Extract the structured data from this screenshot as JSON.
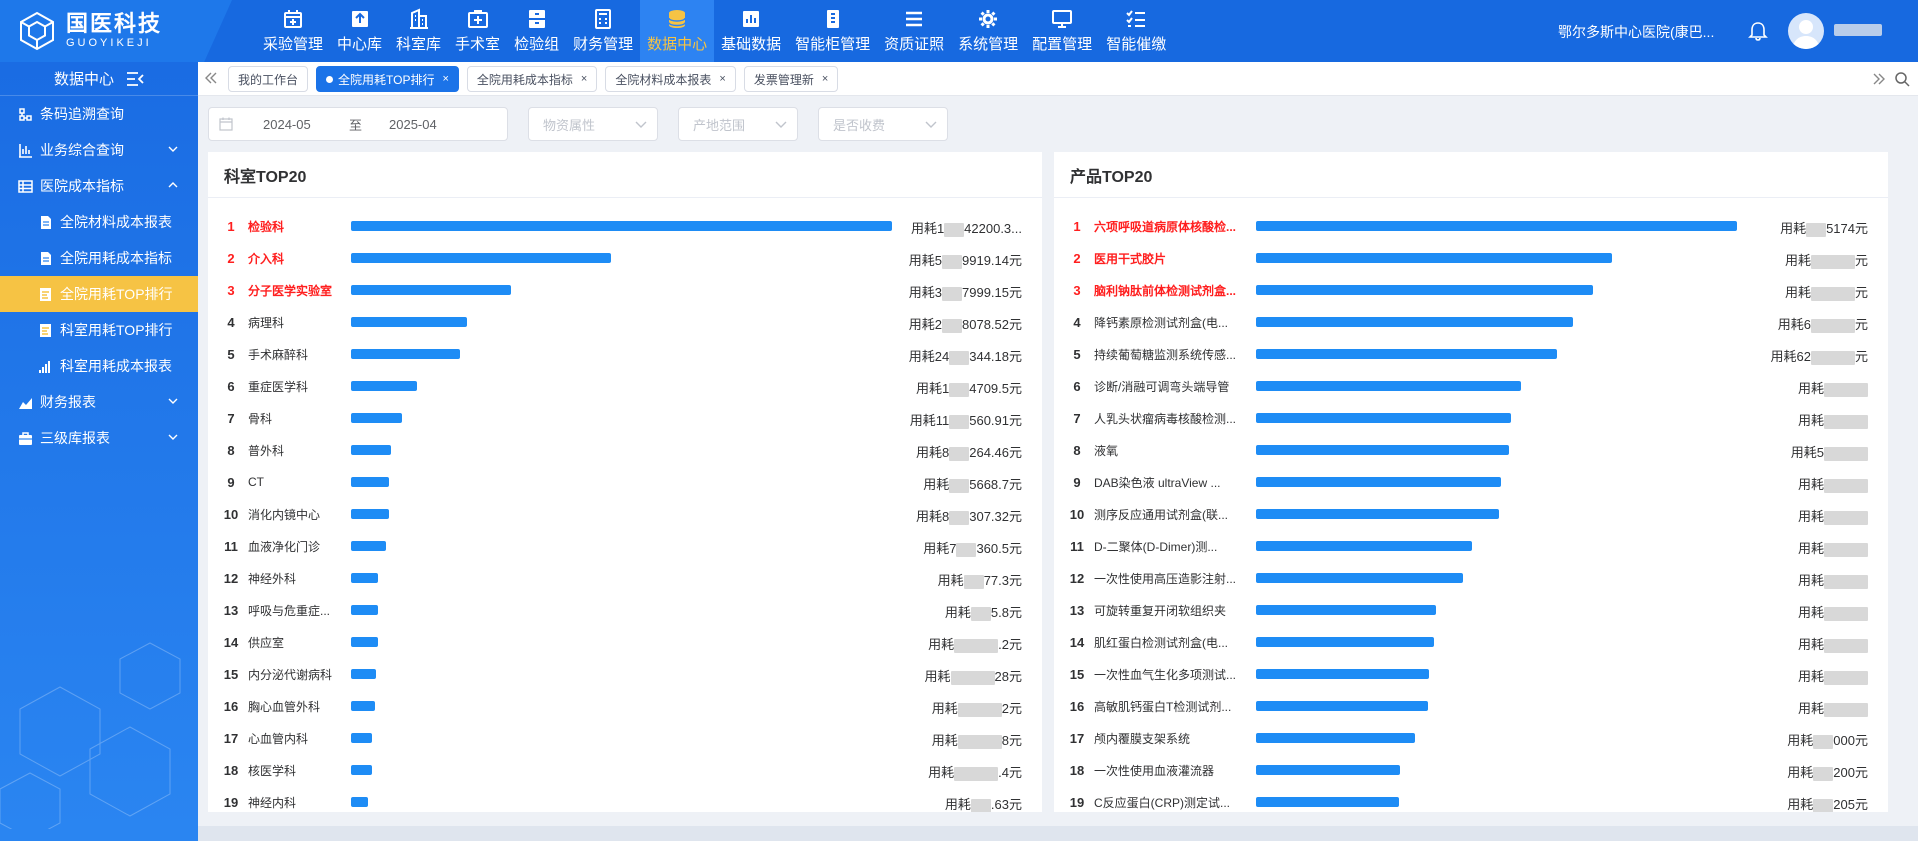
{
  "header": {
    "logo_cn": "国医科技",
    "logo_en": "GUOYIKEJI",
    "nav": [
      {
        "label": "采验管理",
        "icon": "calendar-plus-icon",
        "active": false
      },
      {
        "label": "中心库",
        "icon": "upload-box-icon",
        "active": false
      },
      {
        "label": "科室库",
        "icon": "building-icon",
        "active": false
      },
      {
        "label": "手术室",
        "icon": "medical-kit-icon",
        "active": false
      },
      {
        "label": "检验组",
        "icon": "cabinet-icon",
        "active": false
      },
      {
        "label": "财务管理",
        "icon": "calculator-icon",
        "active": false
      },
      {
        "label": "数据中心",
        "icon": "database-icon",
        "active": true
      },
      {
        "label": "基础数据",
        "icon": "bar-chart-icon",
        "active": false
      },
      {
        "label": "智能柜管理",
        "icon": "smart-cabinet-icon",
        "active": false
      },
      {
        "label": "资质证照",
        "icon": "list-icon",
        "active": false
      },
      {
        "label": "系统管理",
        "icon": "gear-icon",
        "active": false
      },
      {
        "label": "配置管理",
        "icon": "monitor-icon",
        "active": false
      },
      {
        "label": "智能催缴",
        "icon": "checklist-icon",
        "active": false
      }
    ],
    "hospital": "鄂尔多斯中心医院(康巴..."
  },
  "sidebar": {
    "title": "数据中心",
    "items": [
      {
        "label": "条码追溯查询",
        "icon": "tree-icon",
        "sub": false,
        "active": false,
        "chevron": ""
      },
      {
        "label": "业务综合查询",
        "icon": "bar-chart-icon",
        "sub": false,
        "active": false,
        "chevron": "down"
      },
      {
        "label": "医院成本指标",
        "icon": "table-icon",
        "sub": false,
        "active": false,
        "chevron": "up"
      },
      {
        "label": "全院材料成本报表",
        "icon": "document-icon",
        "sub": true,
        "active": false,
        "chevron": ""
      },
      {
        "label": "全院用耗成本指标",
        "icon": "document-icon",
        "sub": true,
        "active": false,
        "chevron": ""
      },
      {
        "label": "全院用耗TOP排行",
        "icon": "ranking-icon",
        "sub": true,
        "active": true,
        "chevron": ""
      },
      {
        "label": "科室用耗TOP排行",
        "icon": "ranking-icon",
        "sub": true,
        "active": false,
        "chevron": ""
      },
      {
        "label": "科室用耗成本报表",
        "icon": "signal-icon",
        "sub": true,
        "active": false,
        "chevron": ""
      },
      {
        "label": "财务报表",
        "icon": "area-chart-icon",
        "sub": false,
        "active": false,
        "chevron": "down"
      },
      {
        "label": "三级库报表",
        "icon": "briefcase-icon",
        "sub": false,
        "active": false,
        "chevron": "down"
      }
    ]
  },
  "tabs": [
    {
      "label": "我的工作台",
      "active": false,
      "closable": false
    },
    {
      "label": "全院用耗TOP排行",
      "active": true,
      "closable": true
    },
    {
      "label": "全院用耗成本指标",
      "active": false,
      "closable": true
    },
    {
      "label": "全院材料成本报表",
      "active": false,
      "closable": true
    },
    {
      "label": "发票管理新",
      "active": false,
      "closable": true
    }
  ],
  "filter": {
    "start": "2024-05",
    "separator": "至",
    "end": "2025-04",
    "material_attr_placeholder": "物资属性",
    "origin_placeholder": "产地范围",
    "charge_placeholder": "是否收费"
  },
  "dept_panel": {
    "title": "科室TOP20",
    "rows": [
      {
        "rank": "1",
        "name": "检验科",
        "fraction": 1.0,
        "pre": "用耗1",
        "post": "42200.3..."
      },
      {
        "rank": "2",
        "name": "介入科",
        "fraction": 0.48,
        "pre": "用耗5",
        "post": "9919.14元"
      },
      {
        "rank": "3",
        "name": "分子医学实验室",
        "fraction": 0.295,
        "pre": "用耗3",
        "post": "7999.15元"
      },
      {
        "rank": "4",
        "name": "病理科",
        "fraction": 0.215,
        "pre": "用耗2",
        "post": "8078.52元"
      },
      {
        "rank": "5",
        "name": "手术麻醉科",
        "fraction": 0.202,
        "pre": "用耗24",
        "post": "344.18元"
      },
      {
        "rank": "6",
        "name": "重症医学科",
        "fraction": 0.122,
        "pre": "用耗1",
        "post": "4709.5元"
      },
      {
        "rank": "7",
        "name": "骨科",
        "fraction": 0.095,
        "pre": "用耗11",
        "post": "560.91元"
      },
      {
        "rank": "8",
        "name": "普外科",
        "fraction": 0.074,
        "pre": "用耗8",
        "post": "264.46元"
      },
      {
        "rank": "9",
        "name": "CT",
        "fraction": 0.071,
        "pre": "用耗",
        "post": "5668.7元"
      },
      {
        "rank": "10",
        "name": "消化内镜中心",
        "fraction": 0.071,
        "pre": "用耗8",
        "post": "307.32元"
      },
      {
        "rank": "11",
        "name": "血液净化门诊",
        "fraction": 0.065,
        "pre": "用耗7",
        "post": "360.5元"
      },
      {
        "rank": "12",
        "name": "神经外科",
        "fraction": 0.05,
        "pre": "用耗",
        "post": "77.3元"
      },
      {
        "rank": "13",
        "name": "呼吸与危重症...",
        "fraction": 0.05,
        "pre": "用耗",
        "post": "5.8元"
      },
      {
        "rank": "14",
        "name": "供应室",
        "fraction": 0.05,
        "pre": "用耗",
        "post": ".2元"
      },
      {
        "rank": "15",
        "name": "内分泌代谢病科",
        "fraction": 0.047,
        "pre": "用耗",
        "post": "28元"
      },
      {
        "rank": "16",
        "name": "胸心血管外科",
        "fraction": 0.045,
        "pre": "用耗",
        "post": "2元"
      },
      {
        "rank": "17",
        "name": "心血管内科",
        "fraction": 0.038,
        "pre": "用耗",
        "post": "8元"
      },
      {
        "rank": "18",
        "name": "核医学科",
        "fraction": 0.038,
        "pre": "用耗",
        "post": ".4元"
      },
      {
        "rank": "19",
        "name": "神经内科",
        "fraction": 0.032,
        "pre": "用耗",
        "post": ".63元"
      }
    ]
  },
  "product_panel": {
    "title": "产品TOP20",
    "rows": [
      {
        "rank": "1",
        "name": "六项呼吸道病原体核酸检...",
        "fraction": 1.0,
        "pre": "用耗",
        "post": "5174元"
      },
      {
        "rank": "2",
        "name": "医用干式胶片",
        "fraction": 0.74,
        "pre": "用耗",
        "post": "元"
      },
      {
        "rank": "3",
        "name": "脑利钠肽前体检测试剂盒...",
        "fraction": 0.7,
        "pre": "用耗",
        "post": "元"
      },
      {
        "rank": "4",
        "name": "降钙素原检测试剂盒(电...",
        "fraction": 0.66,
        "pre": "用耗6",
        "post": "元"
      },
      {
        "rank": "5",
        "name": "持续葡萄糖监测系统传感...",
        "fraction": 0.625,
        "pre": "用耗62",
        "post": "元"
      },
      {
        "rank": "6",
        "name": "诊断/消融可调弯头端导管",
        "fraction": 0.55,
        "pre": "用耗",
        "post": ""
      },
      {
        "rank": "7",
        "name": "人乳头状瘤病毒核酸检测...",
        "fraction": 0.53,
        "pre": "用耗",
        "post": ""
      },
      {
        "rank": "8",
        "name": "液氧",
        "fraction": 0.525,
        "pre": "用耗5",
        "post": ""
      },
      {
        "rank": "9",
        "name": "DAB染色液 ultraView ...",
        "fraction": 0.51,
        "pre": "用耗",
        "post": ""
      },
      {
        "rank": "10",
        "name": "测序反应通用试剂盒(联...",
        "fraction": 0.505,
        "pre": "用耗",
        "post": ""
      },
      {
        "rank": "11",
        "name": "D-二聚体(D-Dimer)测...",
        "fraction": 0.45,
        "pre": "用耗",
        "post": ""
      },
      {
        "rank": "12",
        "name": "一次性使用高压造影注射...",
        "fraction": 0.43,
        "pre": "用耗",
        "post": ""
      },
      {
        "rank": "13",
        "name": "可旋转重复开闭软组织夹",
        "fraction": 0.375,
        "pre": "用耗",
        "post": ""
      },
      {
        "rank": "14",
        "name": "肌红蛋白检测试剂盒(电...",
        "fraction": 0.37,
        "pre": "用耗",
        "post": ""
      },
      {
        "rank": "15",
        "name": "一次性血气生化多项测试...",
        "fraction": 0.36,
        "pre": "用耗",
        "post": ""
      },
      {
        "rank": "16",
        "name": "高敏肌钙蛋白T检测试剂...",
        "fraction": 0.358,
        "pre": "用耗",
        "post": ""
      },
      {
        "rank": "17",
        "name": "颅内覆膜支架系统",
        "fraction": 0.33,
        "pre": "用耗",
        "post": "000元"
      },
      {
        "rank": "18",
        "name": "一次性使用血液灌流器",
        "fraction": 0.3,
        "pre": "用耗",
        "post": "200元"
      },
      {
        "rank": "19",
        "name": "C反应蛋白(CRP)测定试...",
        "fraction": 0.298,
        "pre": "用耗",
        "post": "205元"
      }
    ]
  },
  "colors": {
    "header_bg": "#1769e0",
    "accent_active": "#f6c344",
    "bar": "#1e8cf5",
    "top3_text": "#ff1f1f"
  }
}
